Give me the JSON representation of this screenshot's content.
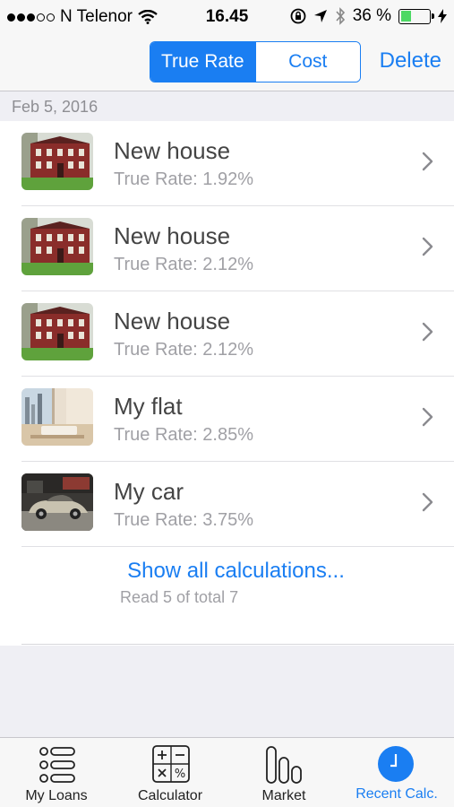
{
  "status_bar": {
    "carrier": "N Telenor",
    "time": "16.45",
    "battery_text": "36 %",
    "battery_level": 0.36
  },
  "nav": {
    "segments": [
      "True Rate",
      "Cost"
    ],
    "selected_segment": "True Rate",
    "delete_label": "Delete"
  },
  "section": {
    "date": "Feb 5, 2016"
  },
  "items": [
    {
      "title": "New house",
      "rate": "True Rate: 1.92%",
      "thumbnail": "house-photo"
    },
    {
      "title": "New house",
      "rate": "True Rate: 2.12%",
      "thumbnail": "house-photo"
    },
    {
      "title": "New house",
      "rate": "True Rate: 2.12%",
      "thumbnail": "house-photo"
    },
    {
      "title": "My flat",
      "rate": "True Rate: 2.85%",
      "thumbnail": "flat-photo"
    },
    {
      "title": "My car",
      "rate": "True Rate: 3.75%",
      "thumbnail": "car-photo"
    }
  ],
  "footer": {
    "show_all": "Show all calculations...",
    "read_count": "Read 5 of total 7"
  },
  "tabs": [
    {
      "label": "My Loans",
      "icon": "list-icon"
    },
    {
      "label": "Calculator",
      "icon": "calculator-icon"
    },
    {
      "label": "Market",
      "icon": "bar-chart-icon"
    },
    {
      "label": "Recent Calc.",
      "icon": "clock-icon",
      "active": true
    }
  ],
  "colors": {
    "accent": "#1a7ef2",
    "battery": "#4cd964"
  }
}
